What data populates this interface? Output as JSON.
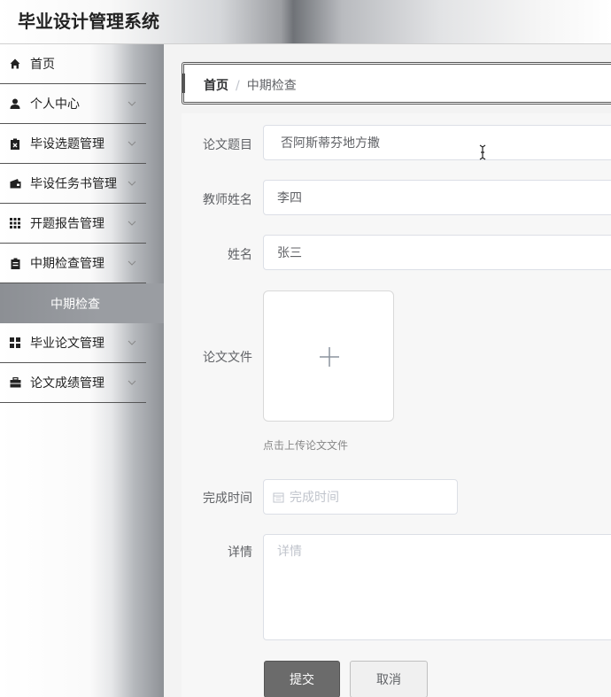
{
  "app": {
    "title": "毕业设计管理系统"
  },
  "sidebar": {
    "items": [
      {
        "label": "首页",
        "icon": "home-icon",
        "has_children": false
      },
      {
        "label": "个人中心",
        "icon": "user-icon",
        "has_children": true
      },
      {
        "label": "毕设选题管理",
        "icon": "clipboard-icon",
        "has_children": true
      },
      {
        "label": "毕设任务书管理",
        "icon": "wallet-icon",
        "has_children": true
      },
      {
        "label": "开题报告管理",
        "icon": "grid-icon",
        "has_children": true
      },
      {
        "label": "中期检查管理",
        "icon": "clipboard-icon",
        "has_children": true
      },
      {
        "label": "毕业论文管理",
        "icon": "apps-icon",
        "has_children": true
      },
      {
        "label": "论文成绩管理",
        "icon": "briefcase-icon",
        "has_children": true
      }
    ],
    "active_submenu": "中期检查"
  },
  "breadcrumb": {
    "home": "首页",
    "separator": "/",
    "current": "中期检查"
  },
  "form": {
    "thesis_title": {
      "label": "论文题目",
      "value": "否阿斯蒂芬地方撒"
    },
    "teacher_name": {
      "label": "教师姓名",
      "value": "李四"
    },
    "name": {
      "label": "姓名",
      "value": "张三"
    },
    "thesis_file": {
      "label": "论文文件",
      "tip": "点击上传论文文件"
    },
    "completion_time": {
      "label": "完成时间",
      "placeholder": "完成时间"
    },
    "details": {
      "label": "详情",
      "placeholder": "详情"
    },
    "submit_label": "提交",
    "cancel_label": "取消"
  },
  "colors": {
    "primary_button": "#6b6b6b",
    "menu_divider": "#555555"
  }
}
